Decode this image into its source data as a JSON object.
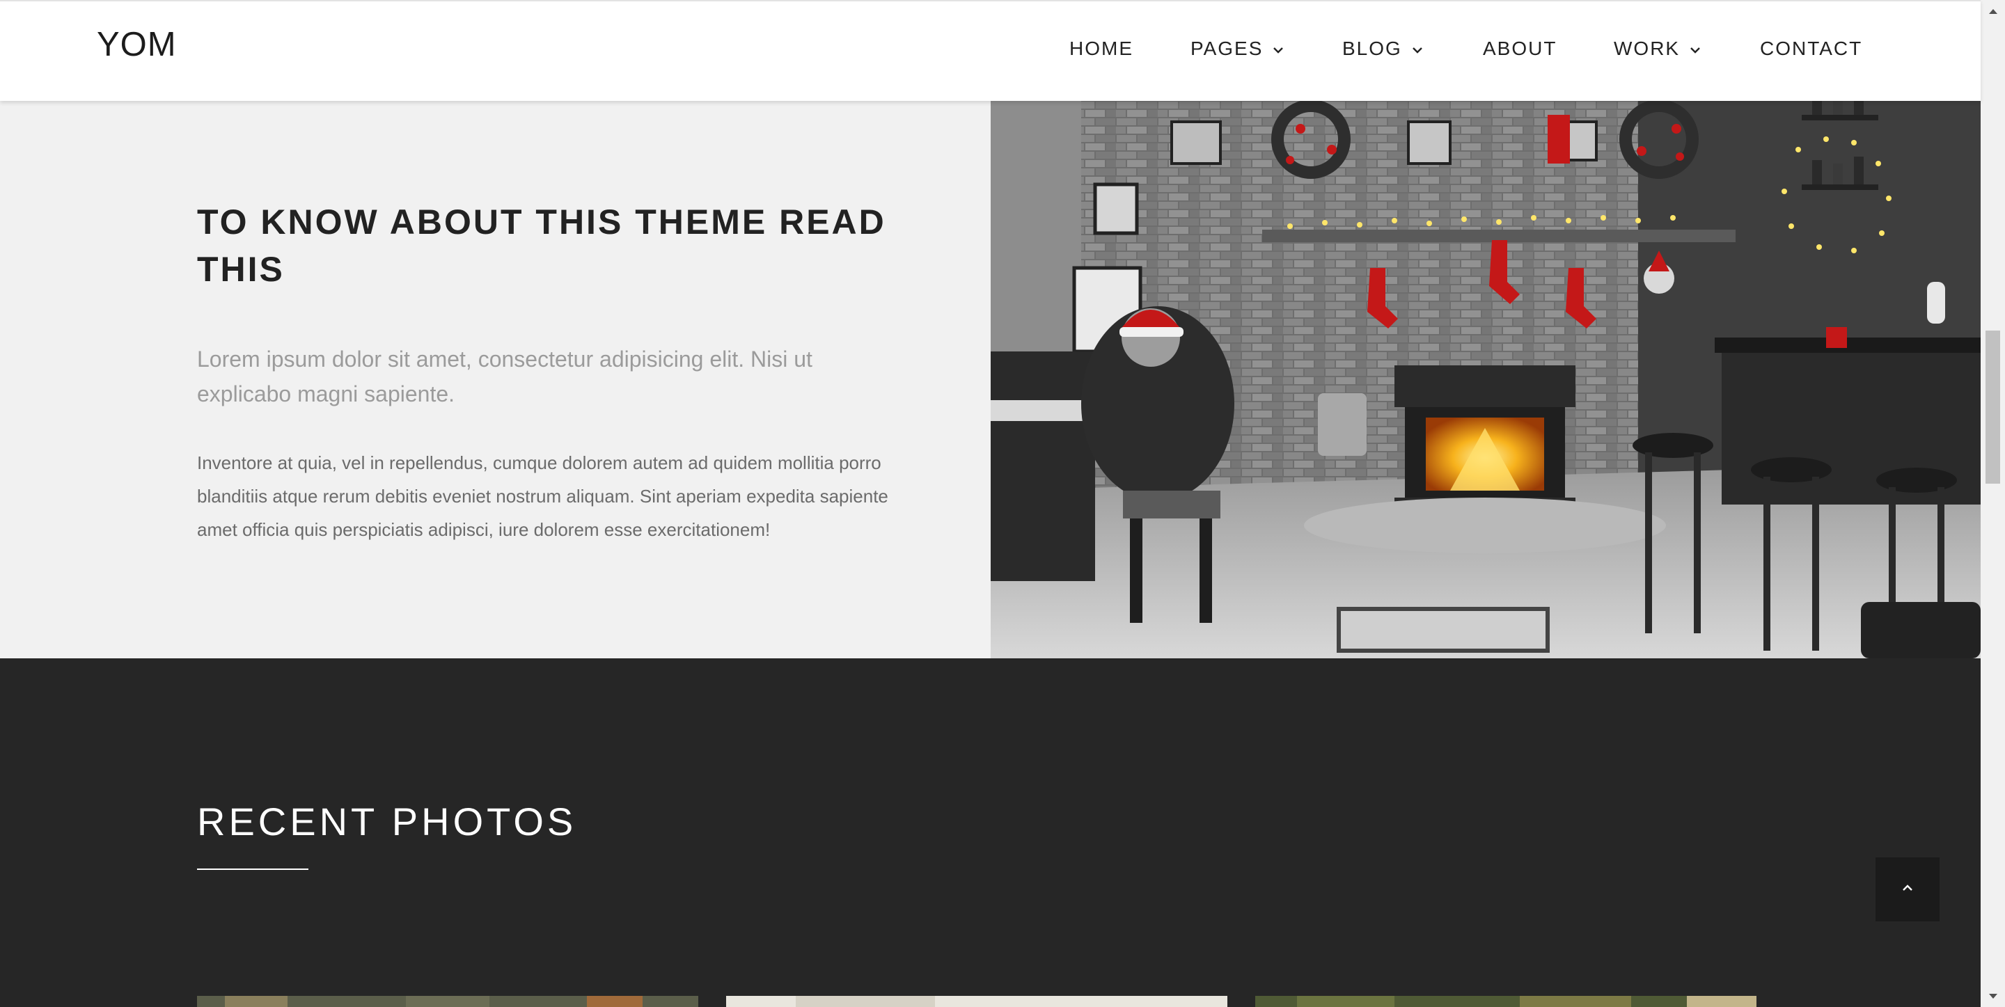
{
  "header": {
    "logo": "YOM",
    "nav": [
      {
        "label": "HOME",
        "dropdown": false
      },
      {
        "label": "PAGES",
        "dropdown": true
      },
      {
        "label": "BLOG",
        "dropdown": true
      },
      {
        "label": "ABOUT",
        "dropdown": false
      },
      {
        "label": "WORK",
        "dropdown": true
      },
      {
        "label": "CONTACT",
        "dropdown": false
      }
    ]
  },
  "intro": {
    "title": "TO KNOW ABOUT THIS THEME READ THIS",
    "lead": "Lorem ipsum dolor sit amet, consectetur adipisicing elit. Nisi ut explicabo magni sapiente.",
    "body": "Inventore at quia, vel in repellendus, cumque dolorem autem ad quidem mollitia porro blanditiis atque rerum debitis eveniet nostrum aliquam. Sint aperiam expedita sapiente amet officia quis perspiciatis adipisci, iure dolorem esse exercitationem!"
  },
  "recent": {
    "title": "RECENT PHOTOS"
  },
  "colors": {
    "text_dark": "#222222",
    "text_muted": "#9b9b9b",
    "intro_bg": "#f1f1f1",
    "dark_bg": "#262626",
    "accent_red": "#c41818"
  },
  "icons": {
    "dropdown": "chevron-down-icon",
    "back_to_top": "chevron-up-icon"
  }
}
